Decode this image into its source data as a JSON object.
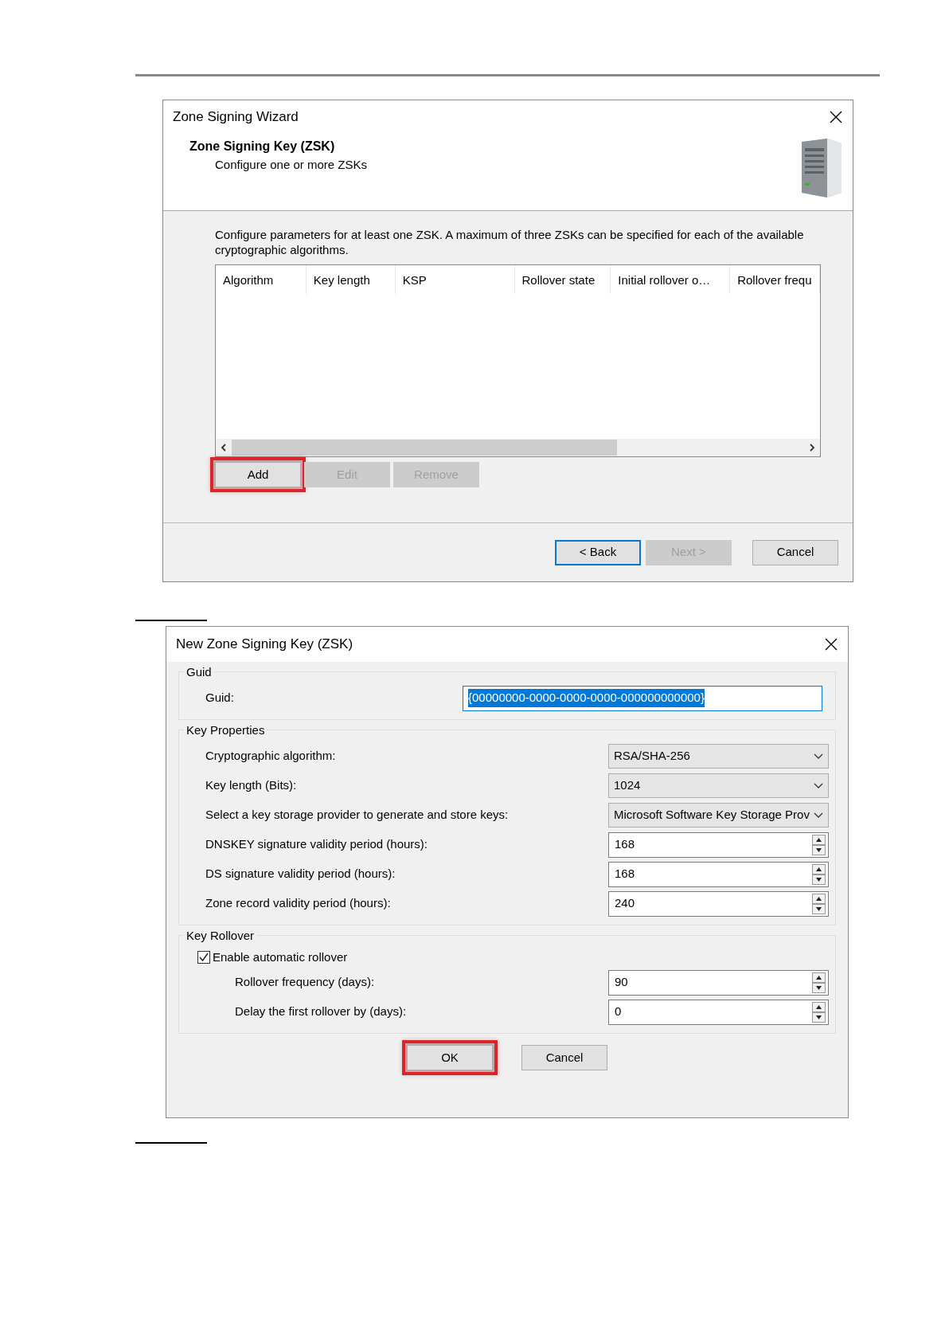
{
  "wizard": {
    "title": "Zone Signing Wizard",
    "header": {
      "title": "Zone Signing Key (ZSK)",
      "subtitle": "Configure one or more ZSKs"
    },
    "description": "Configure parameters for at least one ZSK. A maximum of three ZSKs can be specified for each of the available cryptographic algorithms.",
    "table": {
      "columns": [
        "Algorithm",
        "Key length",
        "KSP",
        "Rollover state",
        "Initial rollover o…",
        "Rollover frequ"
      ]
    },
    "buttons": [
      {
        "label": "Add",
        "disabled": false,
        "highlighted": true
      },
      {
        "label": "Edit",
        "disabled": true,
        "highlighted": false
      },
      {
        "label": "Remove",
        "disabled": true,
        "highlighted": false
      }
    ],
    "nav_buttons": [
      {
        "label": "< Back",
        "disabled": false,
        "default": true
      },
      {
        "label": "Next >",
        "disabled": true,
        "default": false
      },
      {
        "label": "Cancel",
        "disabled": false,
        "default": false
      }
    ]
  },
  "dialog": {
    "title": "New Zone Signing Key (ZSK)",
    "groups": [
      {
        "title": "Guid",
        "rows": [
          {
            "kind": "text",
            "label": "Guid:",
            "value": "{00000000-0000-0000-0000-000000000000}",
            "selected": true
          }
        ]
      },
      {
        "title": "Key Properties",
        "rows": [
          {
            "kind": "dropdown",
            "label": "Cryptographic algorithm:",
            "value": "RSA/SHA-256"
          },
          {
            "kind": "dropdown",
            "label": "Key length (Bits):",
            "value": "1024"
          },
          {
            "kind": "dropdown",
            "label": "Select a key storage provider to generate and store keys:",
            "value": "Microsoft Software Key Storage Prov"
          },
          {
            "kind": "spin",
            "label": "DNSKEY signature validity period (hours):",
            "value": "168"
          },
          {
            "kind": "spin",
            "label": "DS signature validity period (hours):",
            "value": "168"
          },
          {
            "kind": "spin",
            "label": "Zone record validity period (hours):",
            "value": "240"
          }
        ]
      },
      {
        "title": "Key Rollover",
        "checkbox": {
          "label": "Enable automatic rollover",
          "checked": true
        },
        "rows": [
          {
            "kind": "spin",
            "label": "Rollover frequency (days):",
            "value": "90"
          },
          {
            "kind": "spin",
            "label": "Delay the first rollover by (days):",
            "value": "0"
          }
        ]
      }
    ],
    "buttons": [
      {
        "label": "OK",
        "highlighted": true
      },
      {
        "label": "Cancel",
        "highlighted": false
      }
    ]
  }
}
